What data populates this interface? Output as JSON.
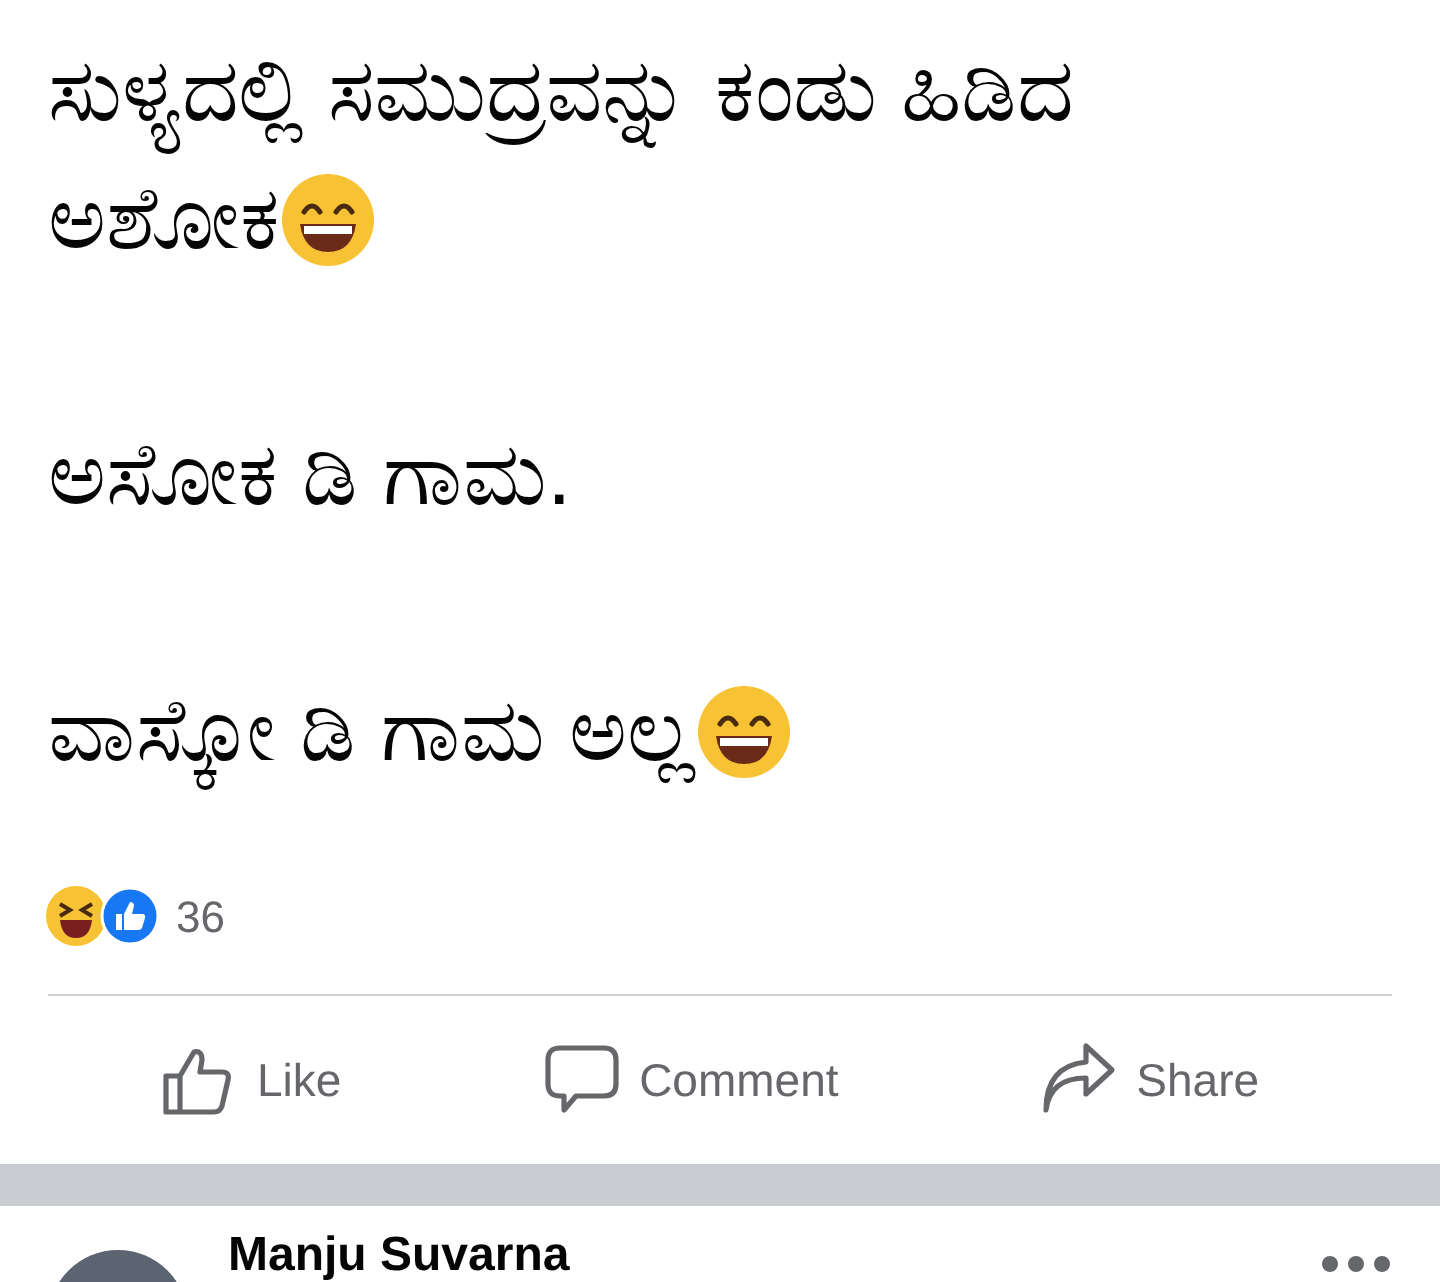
{
  "post": {
    "paragraphs": [
      {
        "text": "ಸುಳ್ಯದಲ್ಲಿ ಸಮುದ್ರವನ್ನು ಕಂಡು ಹಿಡಿದ ಅಶೋಕ",
        "emoji": true
      },
      {
        "text": "ಅಸೋಕ ಡಿ ಗಾಮ.",
        "emoji": false
      },
      {
        "text": "ವಾಸ್ಕೋ ಡಿ ಗಾಮ ಅಲ್ಲ",
        "emoji": true
      }
    ],
    "reaction_count": "36",
    "actions": [
      {
        "kind": "like",
        "label": "Like"
      },
      {
        "kind": "comment",
        "label": "Comment"
      },
      {
        "kind": "share",
        "label": "Share"
      }
    ]
  },
  "next_post": {
    "author": "Manju Suvarna"
  }
}
